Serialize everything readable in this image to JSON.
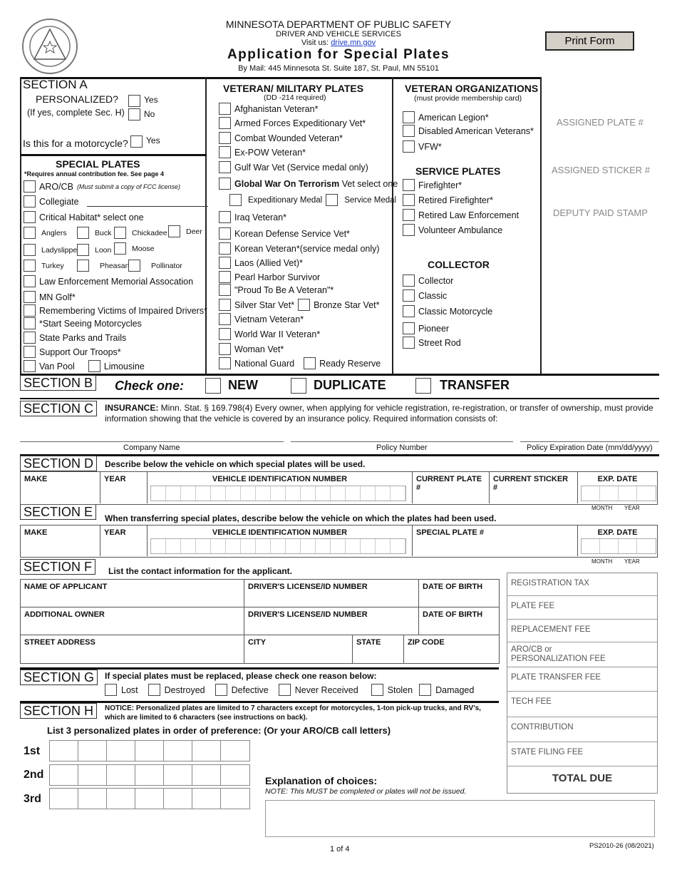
{
  "header": {
    "agency": "MINNESOTA  DEPARTMENT OF PUBLIC SAFETY",
    "division": "DRIVER AND VEHICLE SERVICES",
    "visit_prefix": "Visit us: ",
    "visit_link": "drive.mn.gov",
    "title": "Application for Special Plates",
    "mail": "By Mail: 445 Minnesota St. Suite 187, St. Paul, MN 55101",
    "print_button": "Print Form",
    "seal_icon": "state-seal-icon"
  },
  "section_a": {
    "label": "SECTION A",
    "personalized_q": "PERSONALIZED?",
    "personalized_hint": "(If yes, complete Sec. H)",
    "yes": "Yes",
    "no": "No",
    "motorcycle_q": "Is this for a motorcycle?",
    "motorcycle_yes": "Yes",
    "special_title": "SPECIAL PLATES",
    "special_note": "*Requires annual contribution fee.  See page 4",
    "aro": "ARO/CB",
    "aro_note": "(Must submit a copy of FCC license)",
    "collegiate": "Collegiate",
    "critical": "Critical Habitat* select one",
    "habitat": [
      "Anglers",
      "Buck",
      "Chickadee",
      "Deer",
      "Ladyslipper",
      "Loon",
      "Moose",
      "Turkey",
      "Pheasant",
      "Pollinator"
    ],
    "items": [
      "Law Enforcement Memorial Assocation",
      "MN Golf*",
      "Remembering Victims of Impaired Drivers*",
      "*Start Seeing Motorcycles",
      "State Parks and Trails",
      "Support Our Troops*"
    ],
    "van_pool": "Van Pool",
    "limousine": "Limousine"
  },
  "veteran": {
    "title": "VETERAN/ MILITARY PLATES",
    "subtitle": "(DD -214 required)",
    "items": [
      "Afghanistan Veteran*",
      "Armed Forces Expeditionary Vet*",
      "Combat Wounded Veteran*",
      "Ex-POW Veteran*",
      "Gulf War Vet (Service medal only)"
    ],
    "gwot_bold": "Global War On Terrorism",
    "gwot_rest": " Vet select one",
    "expeditionary": "Expeditionary Medal",
    "service_medal": "Service Medal",
    "items2": [
      "Iraq Veteran*",
      "Korean Defense Service Vet*",
      "Korean Veteran*(service medal only)",
      "Laos (Allied Vet)*",
      "Pearl Harbor Survivor",
      "\"Proud To Be A Veteran\"*"
    ],
    "silver": "Silver Star Vet*",
    "bronze": "Bronze Star Vet*",
    "items3": [
      "Vietnam Veteran*",
      "World War II Veteran*",
      "Woman Vet*"
    ],
    "national_guard": "National Guard",
    "ready_reserve": "Ready Reserve"
  },
  "orgs": {
    "title": "VETERAN ORGANIZATIONS",
    "subtitle": "(must provide membership card)",
    "items": [
      "American Legion*",
      "Disabled American Veterans*",
      "VFW*"
    ],
    "service_title": "SERVICE PLATES",
    "service_items": [
      "Firefighter*",
      "Retired Firefighter*",
      "Retired Law Enforcement",
      "Volunteer Ambulance"
    ],
    "collector_title": "COLLECTOR",
    "collector_items": [
      "Collector",
      "Classic",
      "Classic Motorcycle",
      "Pioneer",
      "Street Rod"
    ]
  },
  "office": {
    "assigned_plate": "ASSIGNED PLATE #",
    "assigned_sticker": "ASSIGNED STICKER #",
    "deputy_stamp": "DEPUTY PAID STAMP"
  },
  "section_b": {
    "label": "SECTION B",
    "check_one": "Check one:",
    "new": "NEW",
    "duplicate": "DUPLICATE",
    "transfer": "TRANSFER"
  },
  "section_c": {
    "label": "SECTION C",
    "insurance_bold": "INSURANCE:",
    "insurance_text": " Minn. Stat. § 169.798(4) Every owner, when applying for vehicle registration, re-registration, or transfer of ownership, must provide information showing that the vehicle is covered by an insurance policy. Required information consists of:",
    "company": "Company Name",
    "policy": "Policy Number",
    "expiration": "Policy Expiration Date (mm/dd/yyyy)"
  },
  "section_d": {
    "label": "SECTION D",
    "instruction": "Describe below the vehicle on which special plates will be used.",
    "make": "MAKE",
    "year": "YEAR",
    "vin": "VEHICLE IDENTIFICATION NUMBER",
    "current_plate": "CURRENT PLATE #",
    "current_sticker": "CURRENT STICKER #",
    "exp_date": "EXP. DATE",
    "month": "MONTH",
    "year_small": "YEAR"
  },
  "section_e": {
    "label": "SECTION E",
    "instruction": "When transferring special plates, describe below the vehicle on which the plates had been used.",
    "make": "MAKE",
    "year": "YEAR",
    "vin": "VEHICLE IDENTIFICATION NUMBER",
    "special_plate": "SPECIAL PLATE #",
    "exp_date": "EXP. DATE",
    "month": "MONTH",
    "year_small": "YEAR"
  },
  "section_f": {
    "label": "SECTION F",
    "instruction": "List the contact information for the applicant.",
    "name": "NAME OF APPLICANT",
    "dl": "DRIVER'S LICENSE/ID NUMBER",
    "dob": "DATE OF BIRTH",
    "additional": "ADDITIONAL OWNER",
    "dl2": "DRIVER'S LICENSE/ID NUMBER",
    "dob2": "DATE OF BIRTH",
    "street": "STREET ADDRESS",
    "city": "CITY",
    "state": "STATE",
    "zip": "ZIP CODE"
  },
  "fees": [
    "REGISTRATION TAX",
    "PLATE FEE",
    "REPLACEMENT FEE",
    "ARO/CB or PERSONALIZATION FEE",
    "PLATE TRANSFER FEE",
    "TECH FEE",
    "CONTRIBUTION",
    "STATE FILING FEE"
  ],
  "total_due": "TOTAL DUE",
  "section_g": {
    "label": "SECTION G",
    "instruction": "If special plates must be replaced, please check one reason below:",
    "reasons": [
      "Lost",
      "Destroyed",
      "Defective",
      "Never Received",
      "Stolen",
      "Damaged"
    ]
  },
  "section_h": {
    "label": "SECTION H",
    "notice": "NOTICE: Personalized plates are limited to 7 characters except for motorcycles, 1-ton pick-up trucks, and RV's, which are limited to 6 characters (see instructions on back).",
    "list_instruction": "List 3 personalized plates in order of preference: (Or your ARO/CB call letters)",
    "choices": [
      "1st",
      "2nd",
      "3rd"
    ],
    "explanation": "Explanation of choices:",
    "explanation_note": "NOTE: This MUST be completed or plates will not be issued."
  },
  "footer": {
    "page": "1 of 4",
    "form_id": "PS2010-26 (08/2021)"
  }
}
